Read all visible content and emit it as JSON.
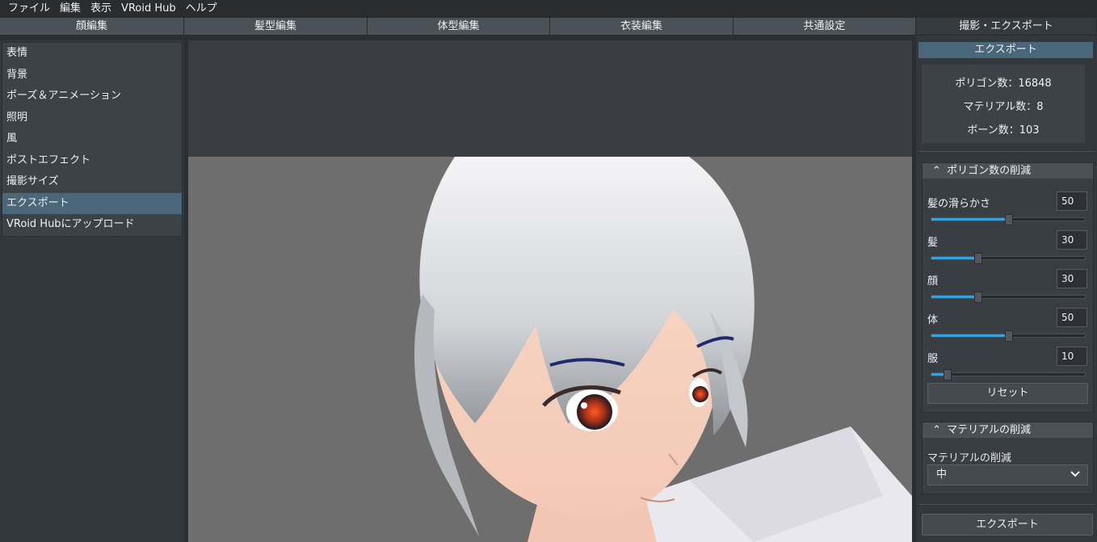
{
  "menubar": {
    "items": [
      "ファイル",
      "編集",
      "表示",
      "VRoid Hub",
      "ヘルプ"
    ]
  },
  "tabs": [
    "顔編集",
    "髪型編集",
    "体型編集",
    "衣装編集",
    "共通設定",
    "撮影・エクスポート"
  ],
  "left_menu": {
    "items": [
      "表情",
      "背景",
      "ポーズ＆アニメーション",
      "照明",
      "風",
      "ポストエフェクト",
      "撮影サイズ",
      "エクスポート",
      "VRoid Hubにアップロード"
    ]
  },
  "right_panel": {
    "header": "エクスポート",
    "stats": {
      "polygons": "ポリゴン数：16848",
      "materials": "マテリアル数：8",
      "bones": "ボーン数：103"
    },
    "polygon_group": {
      "title": "ポリゴン数の削減",
      "sliders": [
        {
          "label": "髪の滑らかさ",
          "value": "50",
          "level": 0.5
        },
        {
          "label": "髪",
          "value": "30",
          "level": 0.3
        },
        {
          "label": "顔",
          "value": "30",
          "level": 0.3
        },
        {
          "label": "体",
          "value": "50",
          "level": 0.5
        },
        {
          "label": "服",
          "value": "10",
          "level": 0.1
        }
      ],
      "reset": "リセット"
    },
    "material_group": {
      "title": "マテリアルの削減",
      "label": "マテリアルの削減",
      "selected": "中"
    },
    "export_button": "エクスポート"
  },
  "colors": {
    "accent": "#3aa0de",
    "selected": "#4a6679",
    "panel": "#33383c"
  }
}
